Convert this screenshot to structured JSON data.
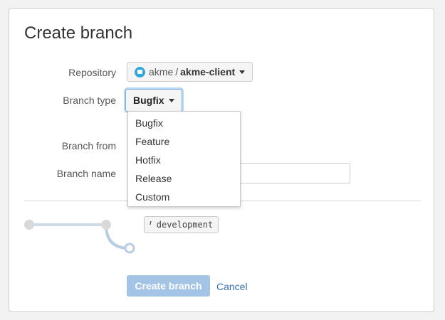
{
  "dialog": {
    "title": "Create branch",
    "colors": {
      "accent": "#3572b0",
      "primary_disabled": "#a3c4e5",
      "focus_ring": "#b9d7f3",
      "graph_line": "#cfdae6"
    }
  },
  "form": {
    "repository": {
      "label": "Repository",
      "icon": "repository-icon",
      "owner": "akme",
      "separator": "/",
      "name": "akme-client"
    },
    "branch_type": {
      "label": "Branch type",
      "selected": "Bugfix",
      "options": [
        "Bugfix",
        "Feature",
        "Hotfix",
        "Release",
        "Custom"
      ]
    },
    "branch_from": {
      "label": "Branch from"
    },
    "branch_name": {
      "label": "Branch name",
      "value": "",
      "placeholder": ""
    }
  },
  "preview": {
    "branch_icon": "branch-icon",
    "source_branch": "development"
  },
  "actions": {
    "create_label": "Create branch",
    "cancel_label": "Cancel"
  }
}
